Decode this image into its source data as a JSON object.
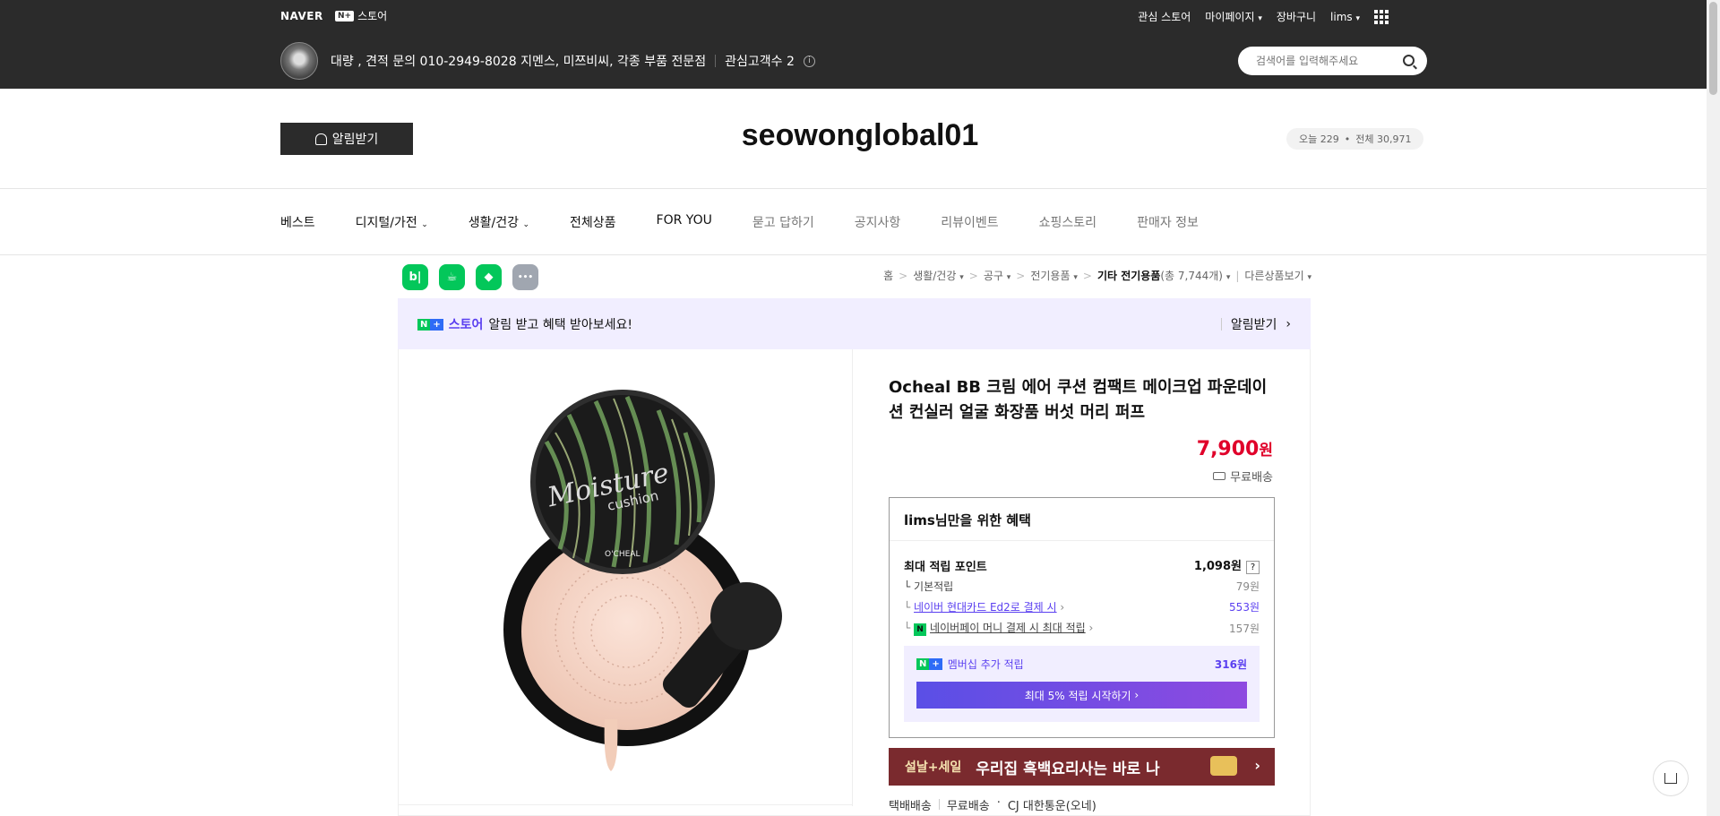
{
  "topbar": {
    "naver": "NAVER",
    "npstore_badge": "N+",
    "npstore_label": "스토어",
    "links": [
      "관심 스토어",
      "마이페이지",
      "장바구니",
      "lims"
    ],
    "store_info": "대량 , 견적 문의 010-2949-8028 지멘스, 미쯔비씨, 각종 부품 전문점",
    "followers": "관심고객수 2",
    "search_placeholder": "검색어를 입력해주세요"
  },
  "header": {
    "alarm_button": "알림받기",
    "store_title": "seowonglobal01",
    "today": "오늘 229",
    "total": "전체 30,971"
  },
  "nav": {
    "items": [
      "베스트",
      "디지털/가전",
      "생활/건강",
      "전체상품",
      "FOR YOU",
      "묻고 답하기",
      "공지사항",
      "리뷰이벤트",
      "쇼핑스토리",
      "판매자 정보"
    ]
  },
  "shares": {
    "blog": "b|",
    "talk": "☕",
    "bookmark": "◆",
    "more": "•••"
  },
  "breadcrumb": {
    "items": [
      "홈",
      "생활/건강",
      "공구",
      "전기용품"
    ],
    "current": "기타 전기용품",
    "count": "(총 7,744개)",
    "other": "다른상품보기"
  },
  "np_banner": {
    "store": "스토어",
    "text": "알림 받고 혜택 받아보세요!",
    "action": "알림받기"
  },
  "product": {
    "title": "Ocheal BB 크림 에어 쿠션 컴팩트 메이크업 파운데이션 컨실러 얼굴 화장품 버섯 머리 퍼프",
    "price": "7,900",
    "price_unit": "원",
    "shipping": "무료배송",
    "image_text_1": "Moisture",
    "image_text_2": "cushion",
    "image_brand": "O'CHEAL"
  },
  "benefit": {
    "title": "lims님만을 위한 혜택",
    "max_point_label": "최대 적립 포인트",
    "max_point_value": "1,098원",
    "rows": [
      {
        "label": "기본적립",
        "value": "79원"
      },
      {
        "label": "네이버 현대카드 Ed2로 결제 시",
        "value": "553원"
      },
      {
        "label": "네이버페이 머니 결제 시 최대 적립",
        "value": "157원"
      }
    ],
    "membership_label": "멤버십 추가 적립",
    "membership_value": "316원",
    "membership_button": "최대 5% 적립 시작하기"
  },
  "promo": {
    "tag": "설날+세일",
    "text": "우리집 흑백요리사는 바로 나"
  },
  "delivery": {
    "type": "택배배송",
    "free": "무료배송",
    "carrier": "CJ 대한통운(오네)"
  },
  "colors": {
    "topbar": "#2b2b2b",
    "price": "#e0002a",
    "purple": "#5a3ff0",
    "naver_green": "#03c75a",
    "promo": "#7a2a2e"
  }
}
